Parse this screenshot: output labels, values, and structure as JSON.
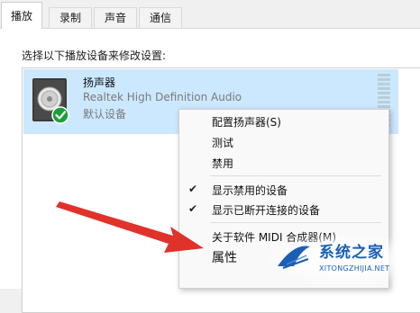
{
  "tabs": [
    {
      "label": "播放"
    },
    {
      "label": "录制"
    },
    {
      "label": "声音"
    },
    {
      "label": "通信"
    }
  ],
  "instruction": "选择以下播放设备来修改设置:",
  "device": {
    "name": "扬声器",
    "description": "Realtek High Definition Audio",
    "status": "默认设备",
    "icon": "speaker-icon",
    "status_icon": "green-check-icon"
  },
  "context_menu": {
    "items": [
      {
        "label": "配置扬声器(S)",
        "checked": false
      },
      {
        "label": "测试",
        "checked": false
      },
      {
        "label": "禁用",
        "checked": false
      },
      {
        "label": "显示禁用的设备",
        "checked": true
      },
      {
        "label": "显示已断开连接的设备",
        "checked": true
      },
      {
        "label": "关于软件 MIDI 合成器(M)",
        "checked": false
      },
      {
        "label": "属性",
        "checked": false
      }
    ],
    "check_glyph": "✔"
  },
  "annotation": {
    "color": "#e0312b"
  },
  "watermark": {
    "title": "系统之家",
    "url": "XITONGZHIJIA.NET"
  },
  "colors": {
    "selection": "#cce8ff",
    "accent": "#1a5fb4"
  }
}
